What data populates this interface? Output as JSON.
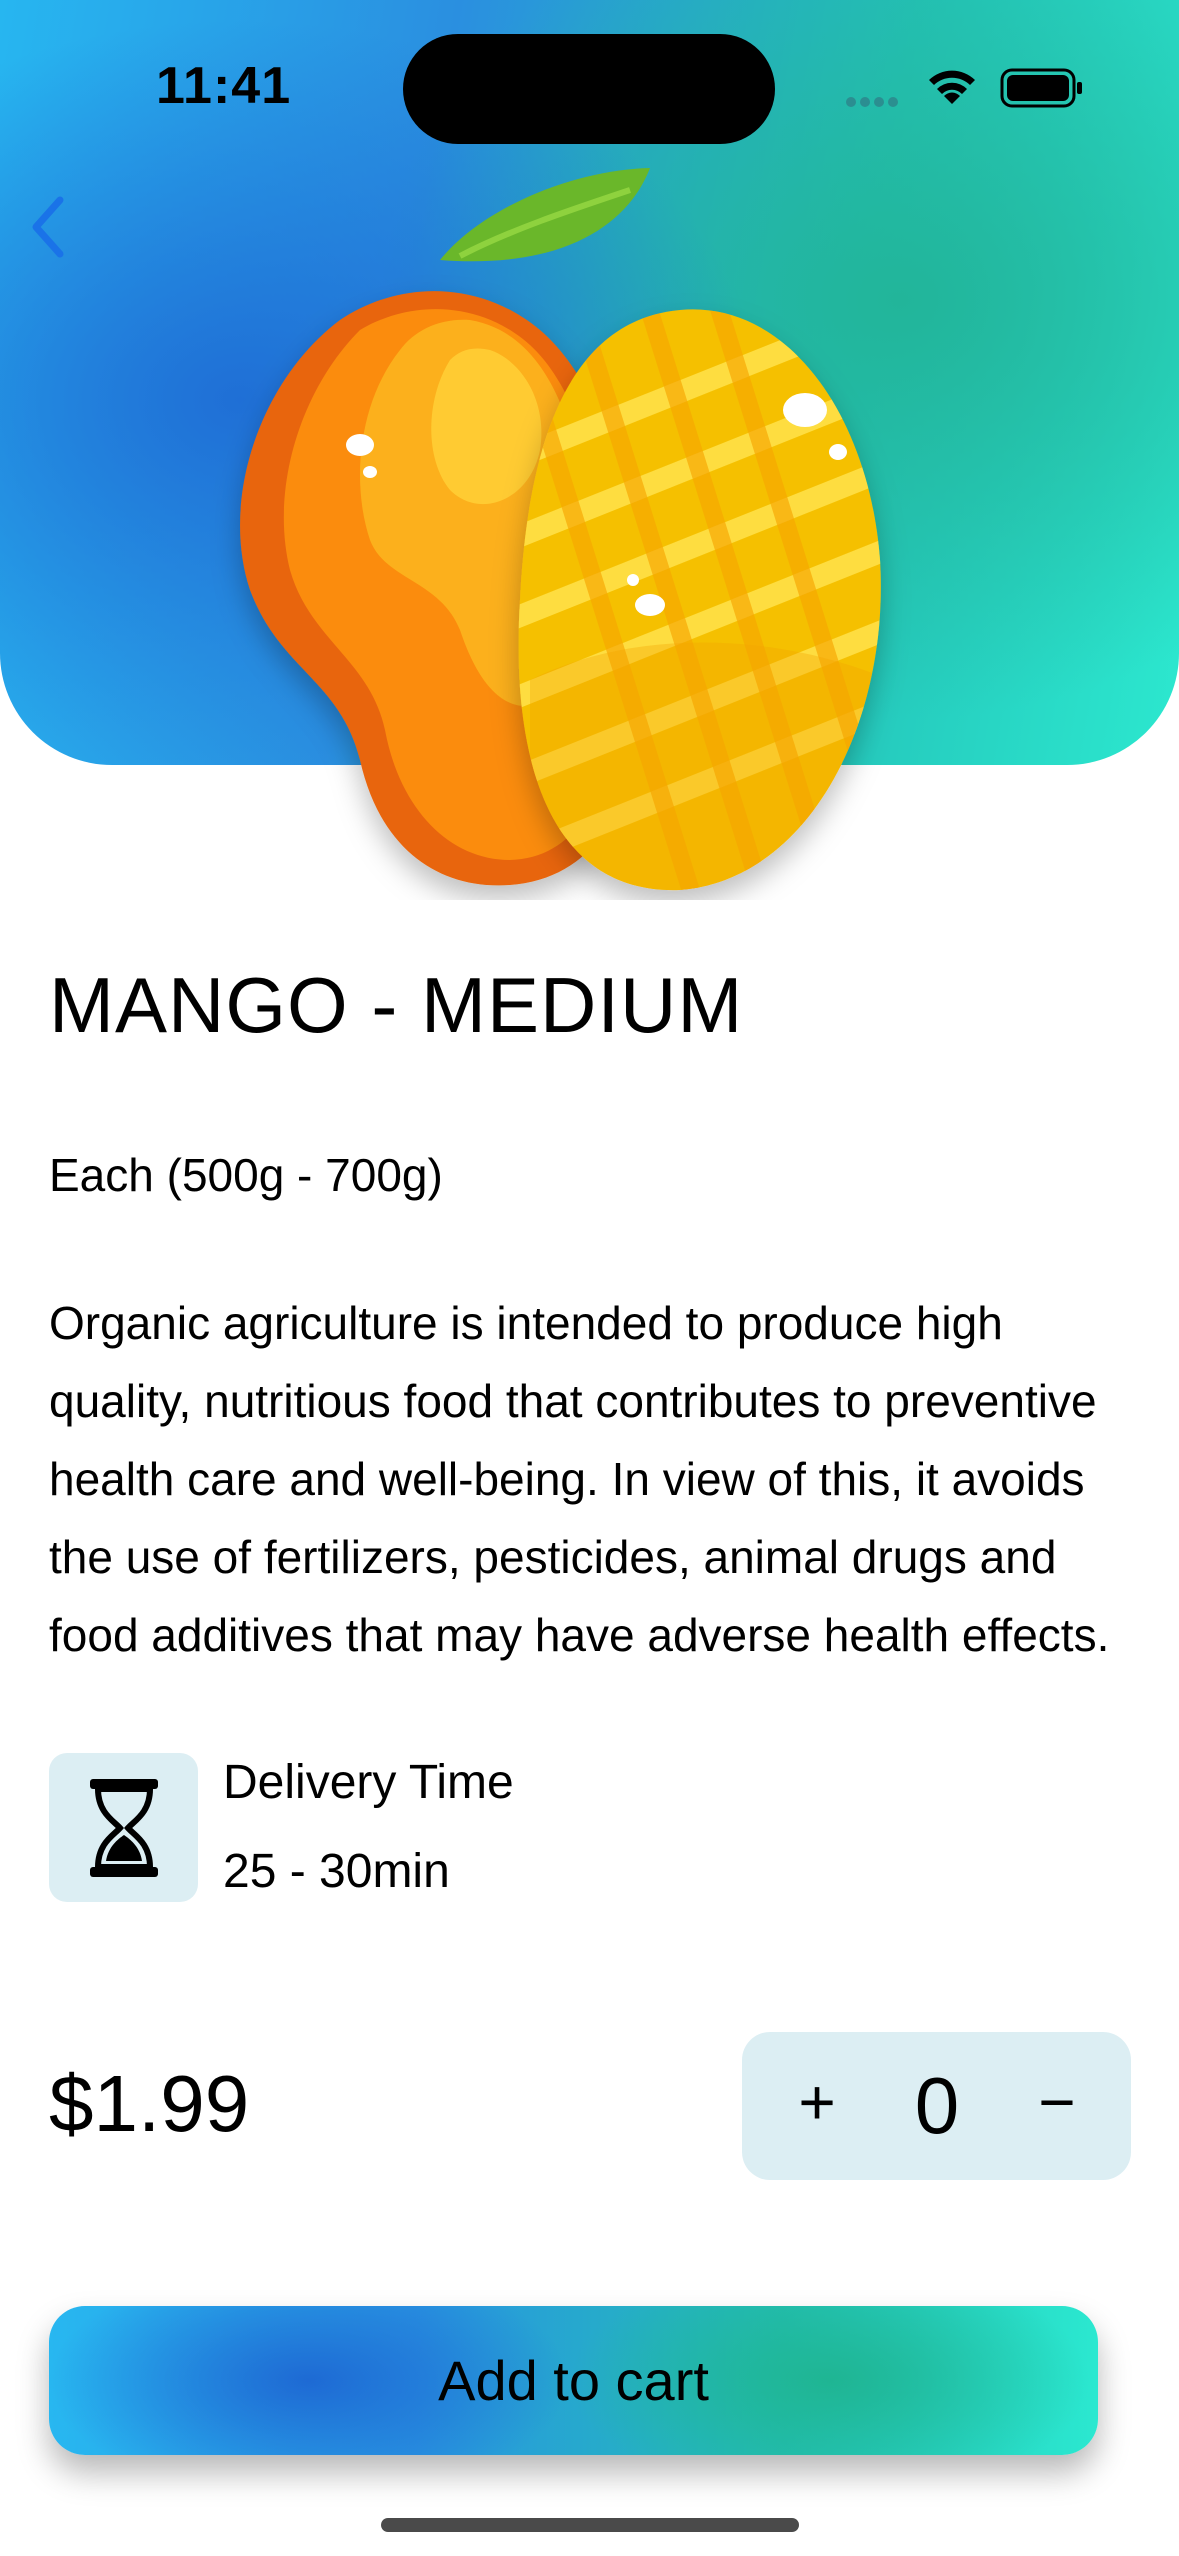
{
  "status_bar": {
    "time": "11:41"
  },
  "nav": {
    "back_icon": "chevron-left-icon"
  },
  "product": {
    "image_icon": "mango-illustration",
    "title": "MANGO - MEDIUM",
    "unit": "Each (500g - 700g)",
    "description": "Organic agriculture is intended to produce high quality, nutritious food that contributes to preventive health care and well-being. In view of this, it avoids the use of fertilizers, pesticides, animal drugs and food additives that may have adverse health effects."
  },
  "delivery": {
    "icon": "hourglass-icon",
    "label": "Delivery Time",
    "value": "25 - 30min"
  },
  "pricing": {
    "price": "$1.99",
    "quantity": "0",
    "plus_label": "+",
    "minus_label": "−"
  },
  "actions": {
    "add_to_cart_label": "Add to cart"
  },
  "colors": {
    "accent_blue": "#1f6fd6",
    "accent_teal": "#2ce8cf",
    "back_chevron": "#1a73e8",
    "stepper_bg": "#dceef3"
  }
}
